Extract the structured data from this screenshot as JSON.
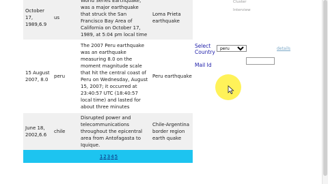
{
  "table": {
    "rows": [
      {
        "date": "October 17, 1989,6.9",
        "country": "us",
        "description": "World Series Earthquake, was a major earthquake that struck the San Francisco Bay Area of California on October 17, 1989, at 5:04 pm local time",
        "name": "Loma Prieta earthquake"
      },
      {
        "date": "15 August 2007, 8.0",
        "country": "peru",
        "description": "The 2007 Peru earthquake was an earthquake measuring 8.0 on the moment magnitude scale that hit the central coast of Peru on Wednesday, August 15, 2007; it occurred at 23:40:57 UTC (18:40:57 local time) and lasted for about three minutes",
        "name": "Peru earthquake"
      },
      {
        "date": "June 18, 2002,6.6",
        "country": "chile",
        "description": "Disrupted power and telecommunications throughout the epicentral area from Antofagasta to Iquique.",
        "name": "Chile-Argentina border region earth quake"
      }
    ],
    "pager": [
      "1",
      "2",
      "3",
      "4",
      "5"
    ]
  },
  "top_links": [
    "Cluster",
    "Interview"
  ],
  "form": {
    "country_label": "Select Country",
    "country_selected": "peru",
    "details_link": "details",
    "mail_label": "Mail Id",
    "mail_value": ""
  }
}
